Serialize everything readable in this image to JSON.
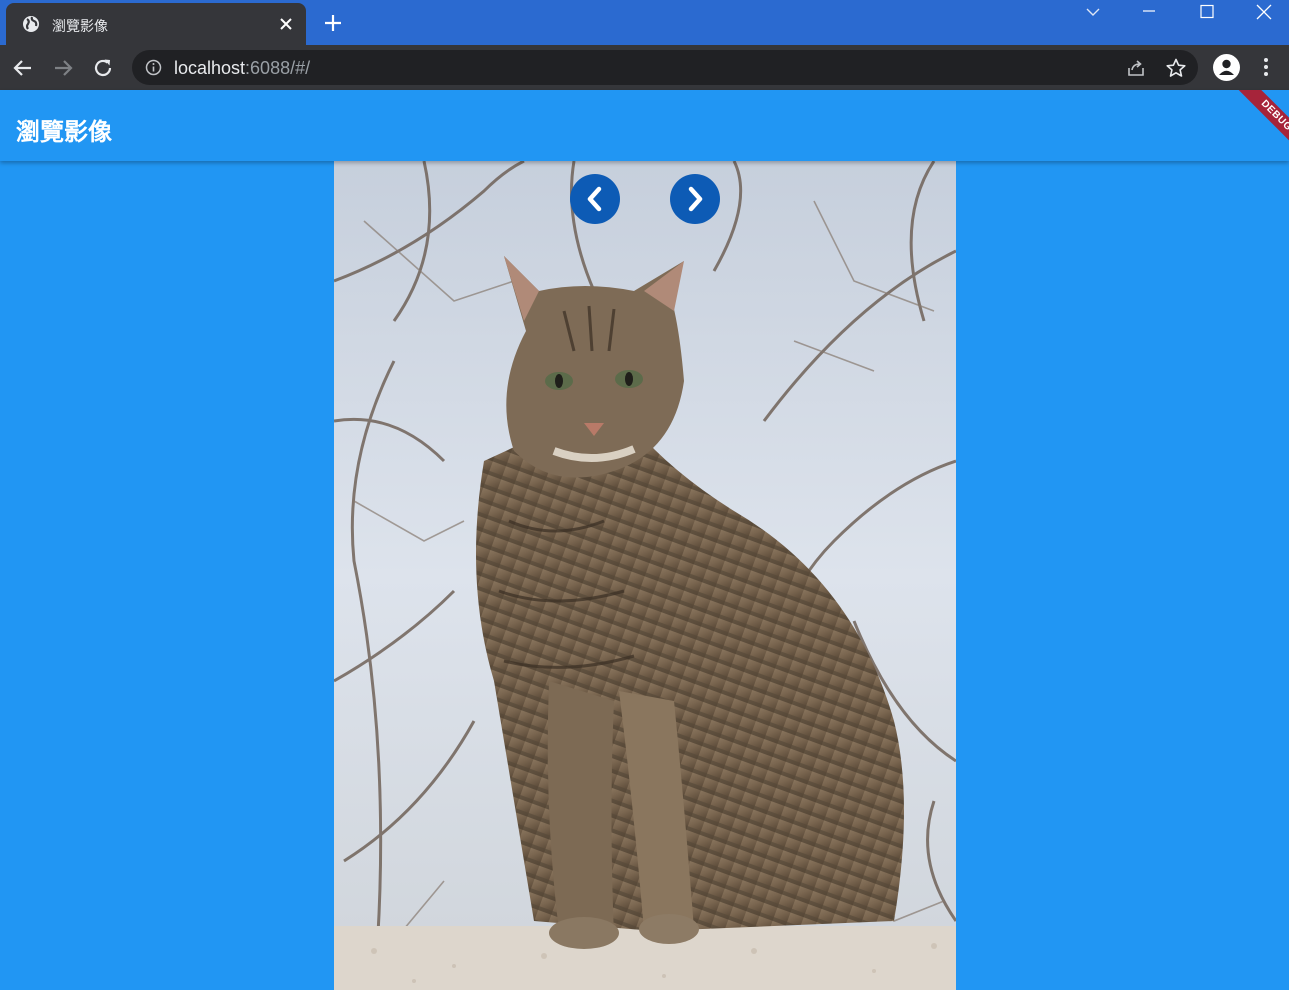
{
  "browser": {
    "tab_title": "瀏覽影像",
    "url_host": "localhost",
    "url_rest": ":6088/#/",
    "icons": [
      "globe-icon",
      "close-icon",
      "plus-icon",
      "chevron-down-icon",
      "minimize-icon",
      "maximize-icon",
      "close-window-icon",
      "back-icon",
      "forward-icon",
      "reload-icon",
      "info-icon",
      "share-icon",
      "star-icon",
      "profile-icon",
      "more-vert-icon"
    ]
  },
  "app": {
    "title": "瀏覽影像",
    "debug_label": "DEBUG",
    "colors": {
      "primary": "#2196f3",
      "nav_button": "#0d5bb5",
      "debug_ribbon": "#a6243a"
    },
    "viewer": {
      "image_subject": "tabby cat",
      "prev_icon": "chevron-left-icon",
      "next_icon": "chevron-right-icon"
    }
  }
}
